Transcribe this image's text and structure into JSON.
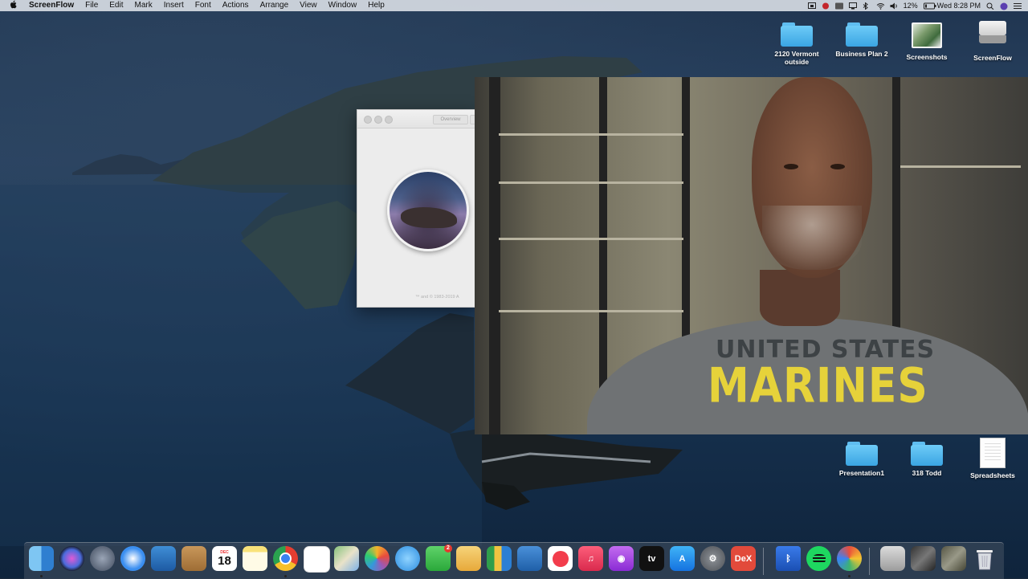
{
  "menubar": {
    "apple": "",
    "app_name": "ScreenFlow",
    "items": [
      "File",
      "Edit",
      "Mark",
      "Insert",
      "Font",
      "Actions",
      "Arrange",
      "View",
      "Window",
      "Help"
    ],
    "battery": "12%",
    "clock": "Wed 8:28 PM"
  },
  "desktop": {
    "top_icons": [
      {
        "label": "2120 Vermont outside",
        "icon": "folder-icon"
      },
      {
        "label": "Business Plan 2",
        "icon": "folder-icon"
      },
      {
        "label": "Screenshots",
        "icon": "image-file-icon"
      },
      {
        "label": "ScreenFlow",
        "icon": "disk-drive-icon"
      }
    ],
    "bottom_icons": [
      {
        "label": "Presentation1",
        "icon": "folder-icon"
      },
      {
        "label": "318 Todd",
        "icon": "folder-icon"
      },
      {
        "label": "Spreadsheets",
        "icon": "document-icon"
      }
    ]
  },
  "about_window": {
    "tab_label": "Overview",
    "copyright": "™ and © 1983-2019 A"
  },
  "webcam": {
    "shirt_line1": "UNITED STATES",
    "shirt_line2": "MARINES"
  },
  "dock": {
    "calendar_day": "18",
    "calendar_month": "DEC",
    "messages_badge": "2",
    "apps": [
      "finder",
      "siri",
      "launchpad",
      "safari",
      "preview",
      "contacts",
      "calendar",
      "notes",
      "chrome",
      "reminders",
      "maps",
      "photos",
      "messages",
      "facetime",
      "sketch",
      "numbers",
      "keynote",
      "news",
      "music",
      "podcasts",
      "tv",
      "app-store",
      "system-preferences",
      "dex",
      "bluetooth",
      "spotify",
      "davinci"
    ],
    "dex_label": "DeX",
    "tv_label": "tv"
  }
}
